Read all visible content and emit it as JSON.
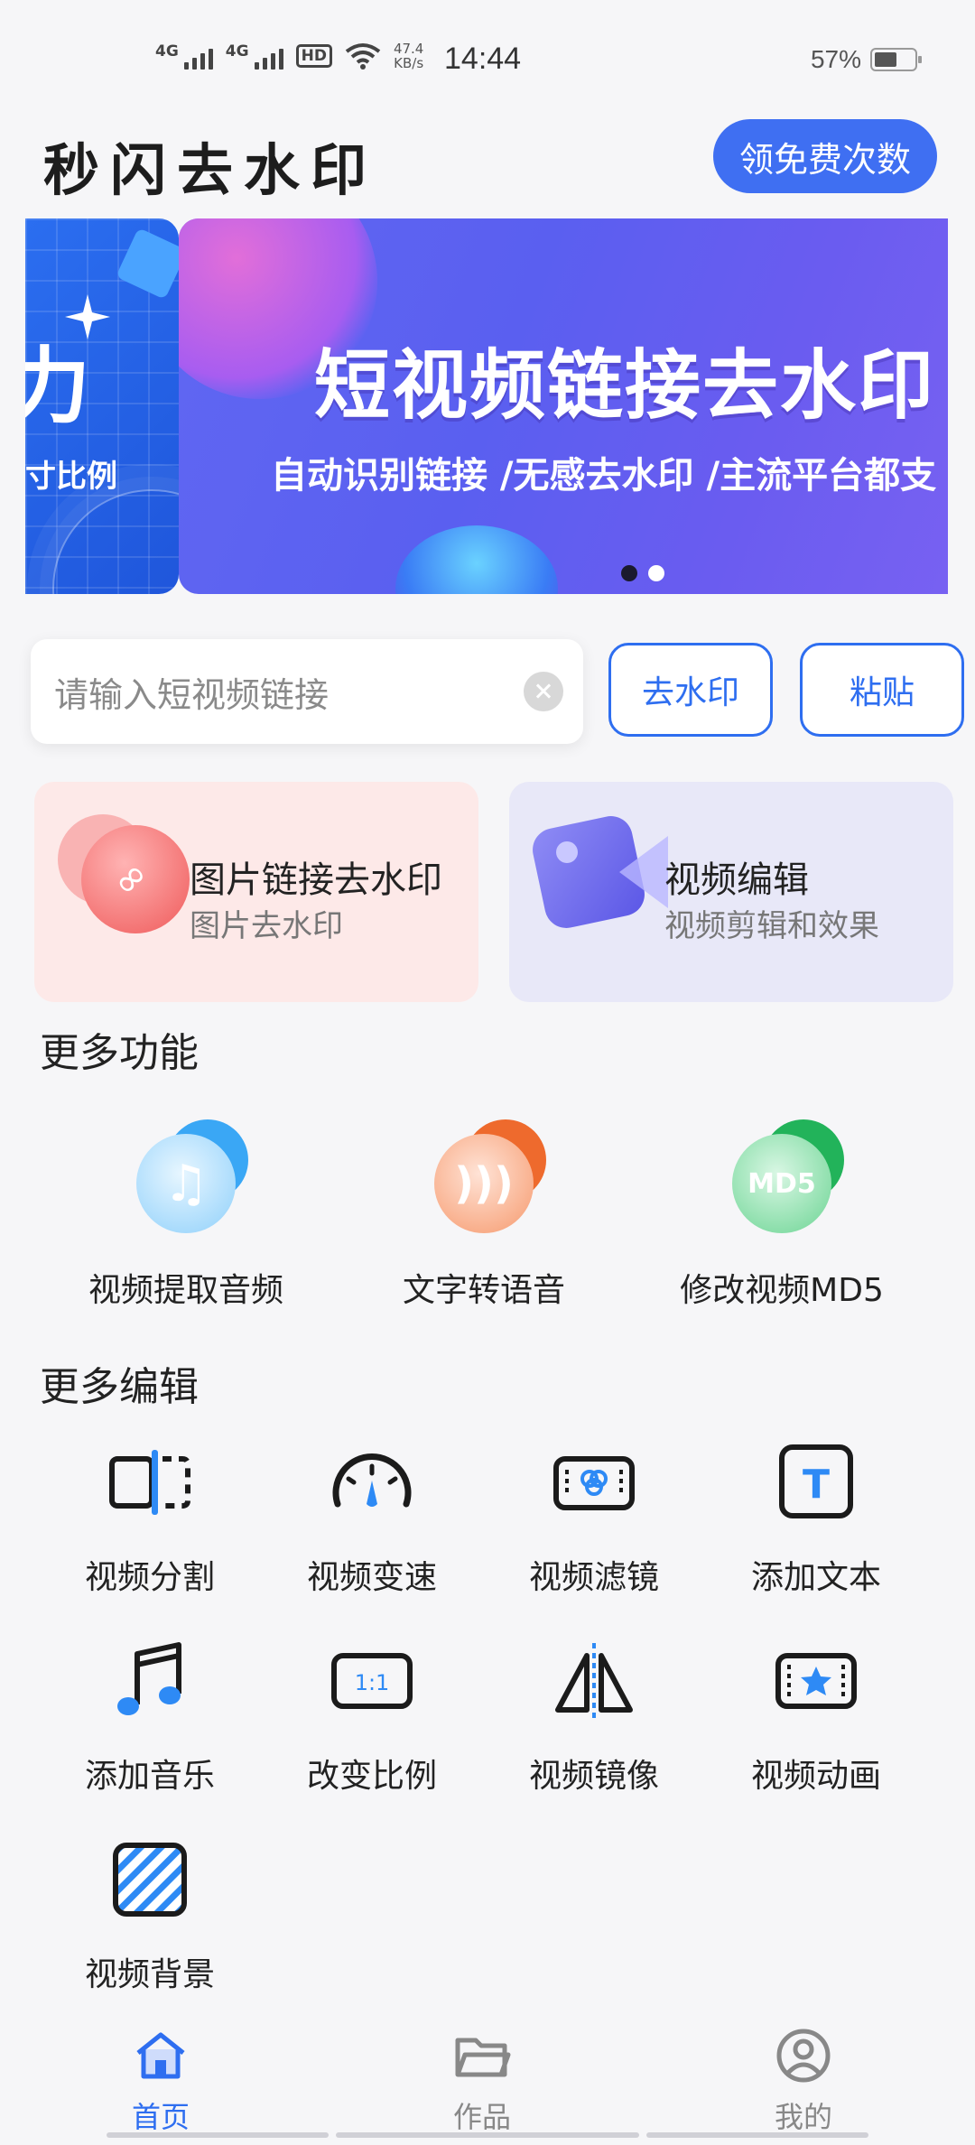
{
  "status_bar": {
    "signal1": "4G",
    "signal2": "4G",
    "hd": "HD",
    "net_speed_value": "47.4",
    "net_speed_unit": "KB/s",
    "time": "14:44",
    "battery": "57%",
    "battery_level": 0.57
  },
  "header": {
    "title": "秒闪去水印",
    "coupon_button": "领免费次数"
  },
  "banner": {
    "prev_big_text": "力",
    "prev_small_text": "寸比例",
    "headline": "短视频链接去水印",
    "subline": "自动识别链接 /无感去水印 /主流平台都支",
    "active_index": 0,
    "total": 2
  },
  "search": {
    "placeholder": "请输入短视频链接",
    "remove_button": "去水印",
    "paste_button": "粘贴"
  },
  "cards": [
    {
      "title": "图片链接去水印",
      "desc": "图片去水印"
    },
    {
      "title": "视频编辑",
      "desc": "视频剪辑和效果"
    }
  ],
  "more_functions": {
    "title": "更多功能",
    "items": [
      {
        "label": "视频提取音频",
        "icon": "music-note-icon"
      },
      {
        "label": "文字转语音",
        "icon": "speaker-wave-icon"
      },
      {
        "label": "修改视频MD5",
        "icon": "md5-icon",
        "icon_text": "MD5"
      }
    ]
  },
  "more_edit": {
    "title": "更多编辑",
    "items": [
      {
        "label": "视频分割",
        "icon": "split-icon"
      },
      {
        "label": "视频变速",
        "icon": "speedometer-icon"
      },
      {
        "label": "视频滤镜",
        "icon": "filter-icon"
      },
      {
        "label": "添加文本",
        "icon": "text-icon",
        "icon_text": "T"
      },
      {
        "label": "添加音乐",
        "icon": "music-icon"
      },
      {
        "label": "改变比例",
        "icon": "ratio-icon",
        "icon_text": "1:1"
      },
      {
        "label": "视频镜像",
        "icon": "mirror-icon"
      },
      {
        "label": "视频动画",
        "icon": "star-film-icon"
      },
      {
        "label": "视频背景",
        "icon": "background-icon"
      }
    ]
  },
  "tabbar": {
    "items": [
      {
        "label": "首页",
        "icon": "home-icon",
        "active": true
      },
      {
        "label": "作品",
        "icon": "folder-icon",
        "active": false
      },
      {
        "label": "我的",
        "icon": "user-icon",
        "active": false
      }
    ]
  },
  "colors": {
    "accent": "#3f6ff2",
    "card_pink": "#fde9e8",
    "card_purple": "#e8e8f8"
  }
}
